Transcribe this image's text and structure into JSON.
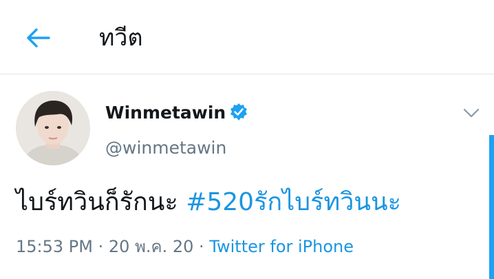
{
  "header": {
    "title": "ทวีต"
  },
  "tweet": {
    "author": {
      "display_name": "Winmetawin",
      "handle": "@winmetawin",
      "verified": true
    },
    "text": "ไบร์ทวินก็รักนะ",
    "hashtag": "#520รักไบร์ทวินนะ",
    "time": "15:53 PM",
    "date": "20 พ.ค. 20",
    "separator": "·",
    "source": "Twitter for iPhone"
  },
  "icons": {
    "back": "back-arrow-icon",
    "verified": "verified-badge-icon",
    "more": "chevron-down-icon"
  },
  "colors": {
    "accent": "#1da1f2",
    "link": "#1b95e0",
    "secondary_text": "#657786",
    "divider": "#e1e8ed"
  }
}
